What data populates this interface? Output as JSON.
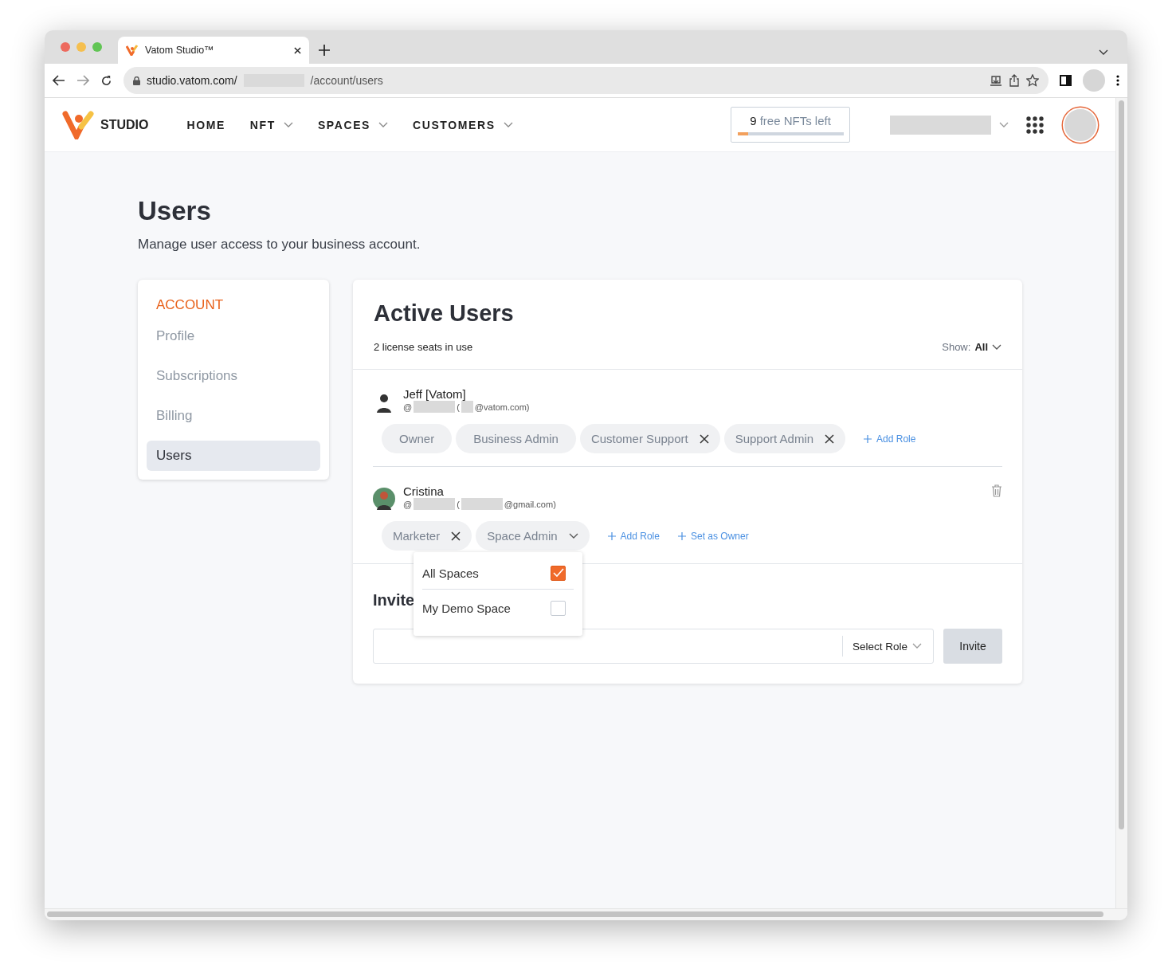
{
  "browser": {
    "tab_title": "Vatom Studio™",
    "url_host": "studio.vatom.com/",
    "url_path": "/account/users"
  },
  "header": {
    "logo_text": "STUDIO",
    "nav": [
      {
        "label": "HOME",
        "dropdown": false
      },
      {
        "label": "NFT",
        "dropdown": true
      },
      {
        "label": "SPACES",
        "dropdown": true
      },
      {
        "label": "CUSTOMERS",
        "dropdown": true
      }
    ],
    "free_nfts": {
      "count": "9",
      "label": "free NFTs left",
      "level": 0.1
    }
  },
  "page": {
    "title": "Users",
    "subtitle": "Manage user access to your business account."
  },
  "sidebar": {
    "heading": "ACCOUNT",
    "items": [
      {
        "label": "Profile",
        "selected": false
      },
      {
        "label": "Subscriptions",
        "selected": false
      },
      {
        "label": "Billing",
        "selected": false
      },
      {
        "label": "Users",
        "selected": true
      }
    ]
  },
  "active_users": {
    "title": "Active Users",
    "seats": "2 license seats in use",
    "show_label": "Show:",
    "show_value": "All",
    "users": [
      {
        "name": "Jeff [Vatom]",
        "handle_prefix": "@",
        "email_open": "(",
        "email_domain": "@vatom.com)",
        "deletable": false,
        "roles": [
          {
            "label": "Owner",
            "kind": "plain"
          },
          {
            "label": "Business Admin",
            "kind": "plain"
          },
          {
            "label": "Customer Support",
            "kind": "removable"
          },
          {
            "label": "Support Admin",
            "kind": "removable"
          }
        ],
        "actions": [
          "Add Role"
        ]
      },
      {
        "name": "Cristina",
        "handle_prefix": "@",
        "email_open": "(",
        "email_domain": "@gmail.com)",
        "deletable": true,
        "roles": [
          {
            "label": "Marketer",
            "kind": "removable"
          },
          {
            "label": "Space Admin",
            "kind": "dropdown",
            "expanded": true,
            "options": [
              {
                "label": "All Spaces",
                "checked": true
              },
              {
                "label": "My Demo Space",
                "checked": false
              }
            ]
          }
        ],
        "actions": [
          "Add Role",
          "Set as Owner"
        ]
      }
    ]
  },
  "invite": {
    "title": "Invite",
    "role_select": "Select Role",
    "button": "Invite"
  }
}
